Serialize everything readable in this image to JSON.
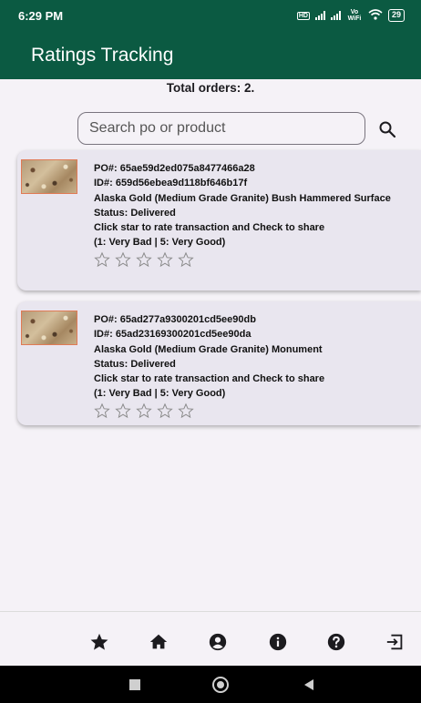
{
  "status_bar": {
    "time": "6:29 PM",
    "network_label": "Vo WiFi",
    "battery": "29"
  },
  "app_bar": {
    "title": "Ratings Tracking"
  },
  "summary": {
    "total_orders": "Total orders: 2."
  },
  "search": {
    "placeholder": "Search po or product",
    "value": ""
  },
  "orders": [
    {
      "po": "PO#: 65ae59d2ed075a8477466a28",
      "id": "ID#: 659d56ebea9d118bf646b17f",
      "product": "Alaska Gold (Medium Grade Granite) Bush Hammered Surface",
      "status": "Status: Delivered",
      "instruction": "Click star to rate transaction and Check to share",
      "scale": "(1: Very Bad | 5: Very Good)",
      "rating": 0
    },
    {
      "po": "PO#: 65ad277a9300201cd5ee90db",
      "id": "ID#: 65ad23169300201cd5ee90da",
      "product": "Alaska Gold (Medium Grade Granite) Monument",
      "status": "Status: Delivered",
      "instruction": "Click star to rate transaction and Check to share",
      "scale": "(1: Very Bad | 5: Very Good)",
      "rating": 0
    }
  ],
  "bottom_nav": [
    {
      "icon": "star-icon"
    },
    {
      "icon": "home-icon"
    },
    {
      "icon": "account-icon"
    },
    {
      "icon": "info-icon"
    },
    {
      "icon": "help-icon"
    },
    {
      "icon": "logout-icon"
    }
  ],
  "colors": {
    "primary": "#0b5a42",
    "background": "#f5f2f7",
    "card": "#e9e6ef",
    "star_outline": "#8a8a8a"
  }
}
